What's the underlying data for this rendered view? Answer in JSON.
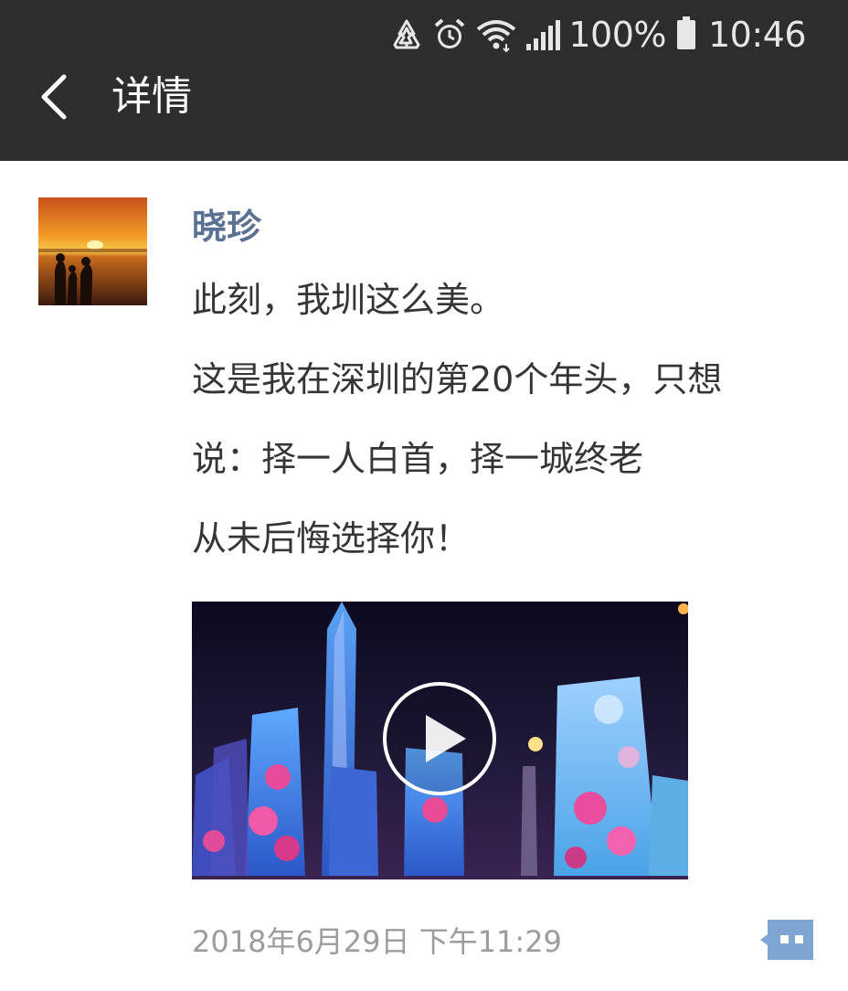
{
  "status_bar": {
    "battery_percent": "100%",
    "time": "10:46",
    "icons": [
      "recycle-icon",
      "alarm-icon",
      "wifi-icon",
      "signal-icon",
      "battery-icon"
    ]
  },
  "nav": {
    "back_icon": "chevron-left-icon",
    "title": "详情"
  },
  "post": {
    "author": "晓珍",
    "lines": [
      "此刻，我圳这么美。",
      "这是我在深圳的第20个年头，只想",
      "说：择一人白首，择一城终老",
      "从未后悔选择你！"
    ],
    "timestamp": "2018年6月29日 下午11:29",
    "comment_icon": "comment-icon",
    "video_icon": "play-icon"
  },
  "colors": {
    "topbar": "#2d2d2d",
    "author": "#5b7191",
    "timestamp": "#9c9c9c",
    "comment_button": "#7fa6d3"
  }
}
